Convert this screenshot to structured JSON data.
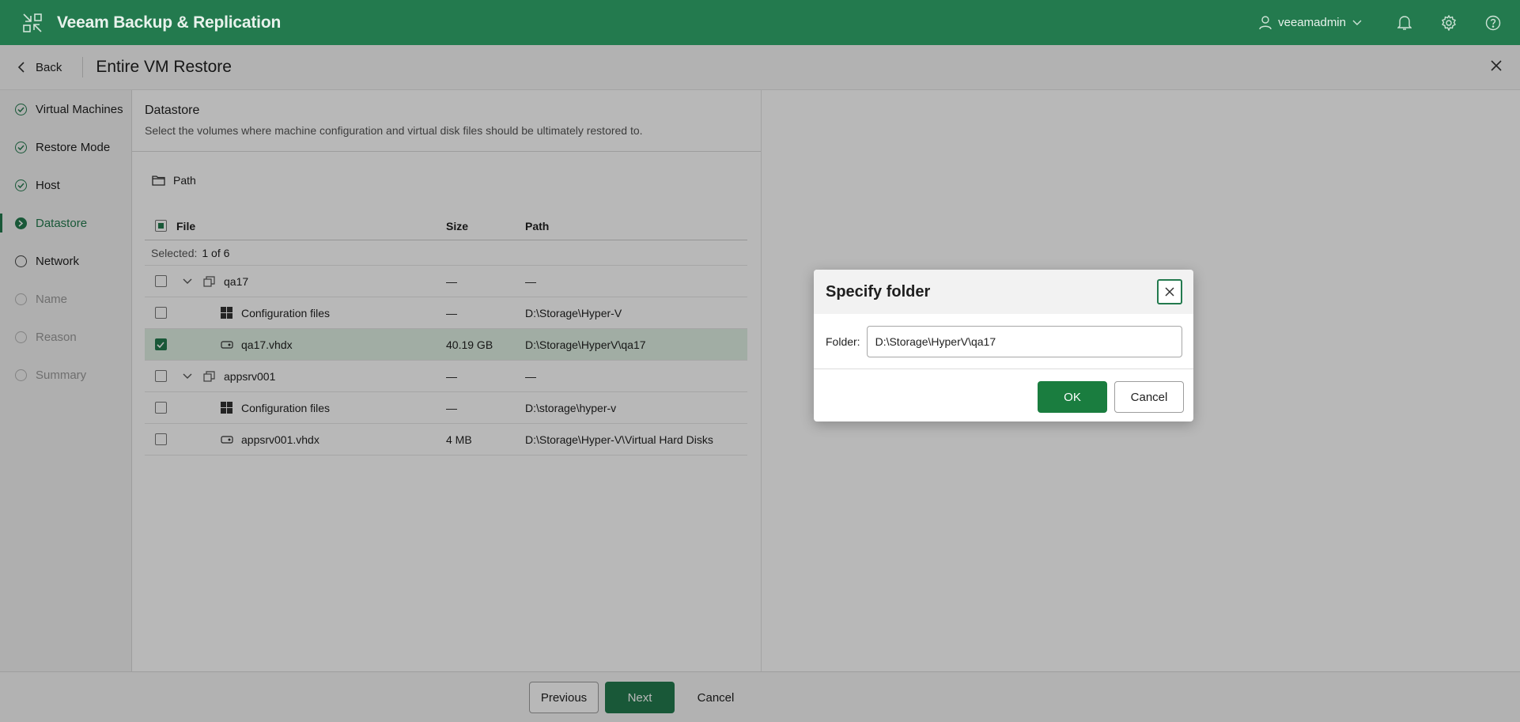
{
  "app": {
    "title": "Veeam Backup & Replication",
    "user": "veeamadmin"
  },
  "colors": {
    "brand": "#237a4e",
    "selected_row": "#dff0e3",
    "ok_button": "#1a7d3f"
  },
  "header": {
    "back_label": "Back",
    "title": "Entire VM Restore"
  },
  "steps": [
    {
      "label": "Virtual Machines",
      "state": "done"
    },
    {
      "label": "Restore Mode",
      "state": "done"
    },
    {
      "label": "Host",
      "state": "done"
    },
    {
      "label": "Datastore",
      "state": "active"
    },
    {
      "label": "Network",
      "state": "todo"
    },
    {
      "label": "Name",
      "state": "disabled"
    },
    {
      "label": "Reason",
      "state": "disabled"
    },
    {
      "label": "Summary",
      "state": "disabled"
    }
  ],
  "section": {
    "title": "Datastore",
    "description": "Select the volumes where machine configuration and virtual disk files should be ultimately restored to.",
    "path_button": "Path"
  },
  "table": {
    "columns": {
      "file": "File",
      "size": "Size",
      "path": "Path"
    },
    "selected_label": "Selected:",
    "selected_value": "1 of 6",
    "rows": [
      {
        "file": "qa17",
        "size": "—",
        "path": "—",
        "type": "vm",
        "checked": false
      },
      {
        "file": "Configuration files",
        "size": "—",
        "path": "D:\\Storage\\Hyper-V",
        "type": "config",
        "checked": false
      },
      {
        "file": "qa17.vhdx",
        "size": "40.19 GB",
        "path": "D:\\Storage\\HyperV\\qa17",
        "type": "disk",
        "checked": true
      },
      {
        "file": "appsrv001",
        "size": "—",
        "path": "—",
        "type": "vm",
        "checked": false
      },
      {
        "file": "Configuration files",
        "size": "—",
        "path": "D:\\storage\\hyper-v",
        "type": "config",
        "checked": false
      },
      {
        "file": "appsrv001.vhdx",
        "size": "4 MB",
        "path": "D:\\Storage\\Hyper-V\\Virtual Hard Disks",
        "type": "disk",
        "checked": false
      }
    ]
  },
  "footer": {
    "previous": "Previous",
    "next": "Next",
    "cancel": "Cancel"
  },
  "dialog": {
    "title": "Specify folder",
    "folder_label": "Folder:",
    "folder_value": "D:\\Storage\\HyperV\\qa17",
    "ok": "OK",
    "cancel": "Cancel"
  },
  "icons": [
    "app-logo-icon",
    "user-icon",
    "chevron-down-icon",
    "bell-icon",
    "gear-icon",
    "help-icon",
    "back-chevron-icon",
    "close-icon",
    "check-circle-icon",
    "folder-icon",
    "vm-icon",
    "windows-icon",
    "disk-icon"
  ]
}
